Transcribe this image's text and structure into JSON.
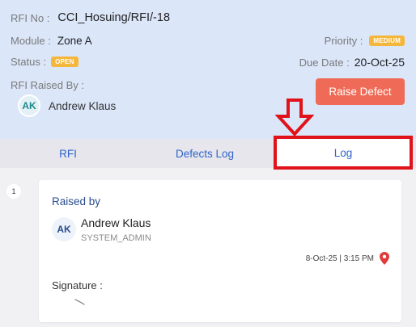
{
  "rfi": {
    "no_label": "RFI No :",
    "no_value": "CCI_Hosuing/RFI/-18",
    "module_label": "Module :",
    "module_value": "Zone A",
    "status_label": "Status :",
    "status_value": "OPEN",
    "priority_label": "Priority :",
    "priority_value": "MEDIUM",
    "due_label": "Due Date :",
    "due_value": "20-Oct-25",
    "raised_by_label": "RFI Raised By :",
    "raised_by_initials": "AK",
    "raised_by_name": "Andrew Klaus",
    "raise_defect_label": "Raise Defect"
  },
  "tabs": [
    {
      "label": "RFI"
    },
    {
      "label": "Defects Log"
    },
    {
      "label": "Log",
      "active": true
    }
  ],
  "log": {
    "entries": [
      {
        "step": "1",
        "title": "Raised by",
        "initials": "AK",
        "name": "Andrew Klaus",
        "role": "SYSTEM_ADMIN",
        "timestamp": "8-Oct-25 | 3:15 PM",
        "signature_label": "Signature :"
      }
    ]
  },
  "colors": {
    "header_bg": "#dbe6f9",
    "accent_blue": "#2f64c9",
    "status_open": "#f5b73b",
    "priority_medium": "#f5b73b",
    "raise_defect": "#ef6b57",
    "highlight_red": "#e0121a",
    "pin_red": "#e03a3a"
  },
  "icons": {
    "location": "location-pin-icon",
    "annotation": "down-arrow-icon"
  }
}
